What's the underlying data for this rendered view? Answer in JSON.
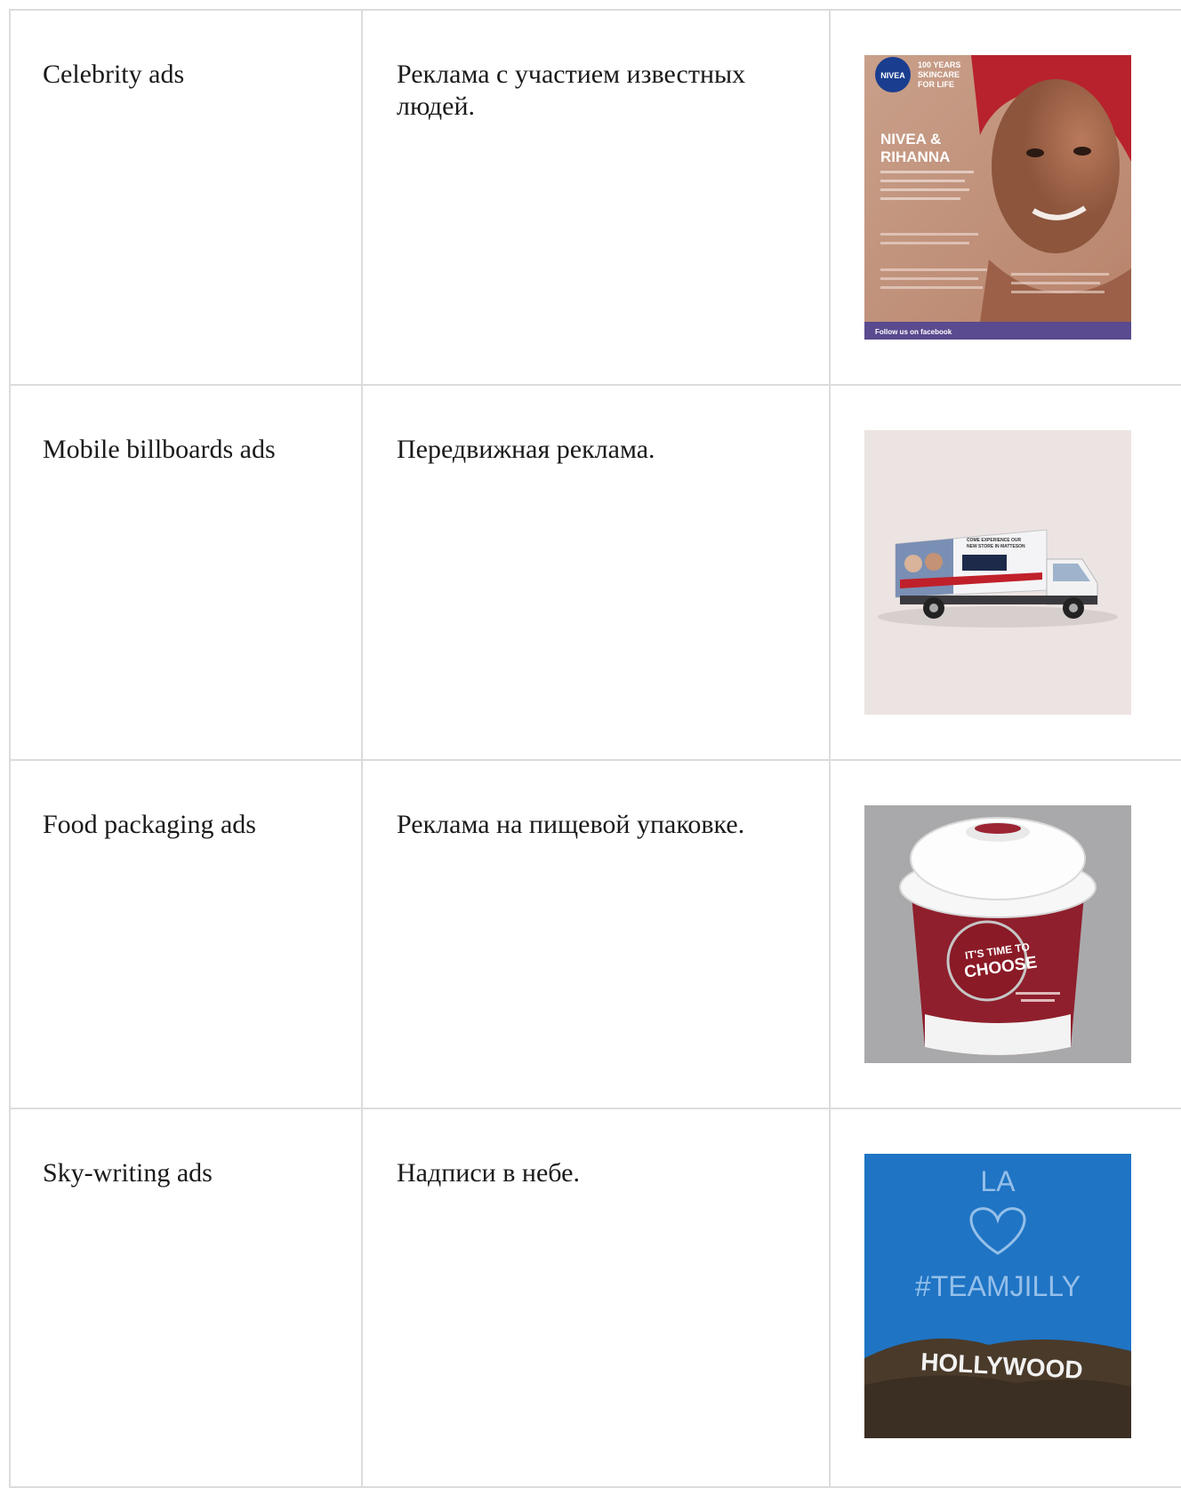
{
  "rows": [
    {
      "term": "Celebrity ads",
      "description": "Реклама с участием известных людей.",
      "image": {
        "brand_badge": "NIVEA",
        "headline_top": "100 YEARS",
        "headline_mid": "SKINCARE",
        "headline_bot": "FOR LIFE",
        "main_line1": "NIVEA &",
        "main_line2": "RIHANNA",
        "footer": "Follow us on facebook"
      }
    },
    {
      "term": "Mobile billboards ads",
      "description": "Передвижная реклама.",
      "image": {
        "truck_text1": "COME EXPERIENCE OUR",
        "truck_text2": "NEW STORE IN MATTESON"
      }
    },
    {
      "term": "Food packaging ads",
      "description": "Реклама на пищевой упаковке.",
      "image": {
        "cup_line1": "IT'S TIME TO",
        "cup_line2": "CHOOSE"
      }
    },
    {
      "term": "Sky-writing ads",
      "description": "Надписи в небе.",
      "image": {
        "sky_line1": "LA",
        "sky_line2": "#TEAMJILLY",
        "sign": "HOLLYWOOD"
      }
    }
  ]
}
